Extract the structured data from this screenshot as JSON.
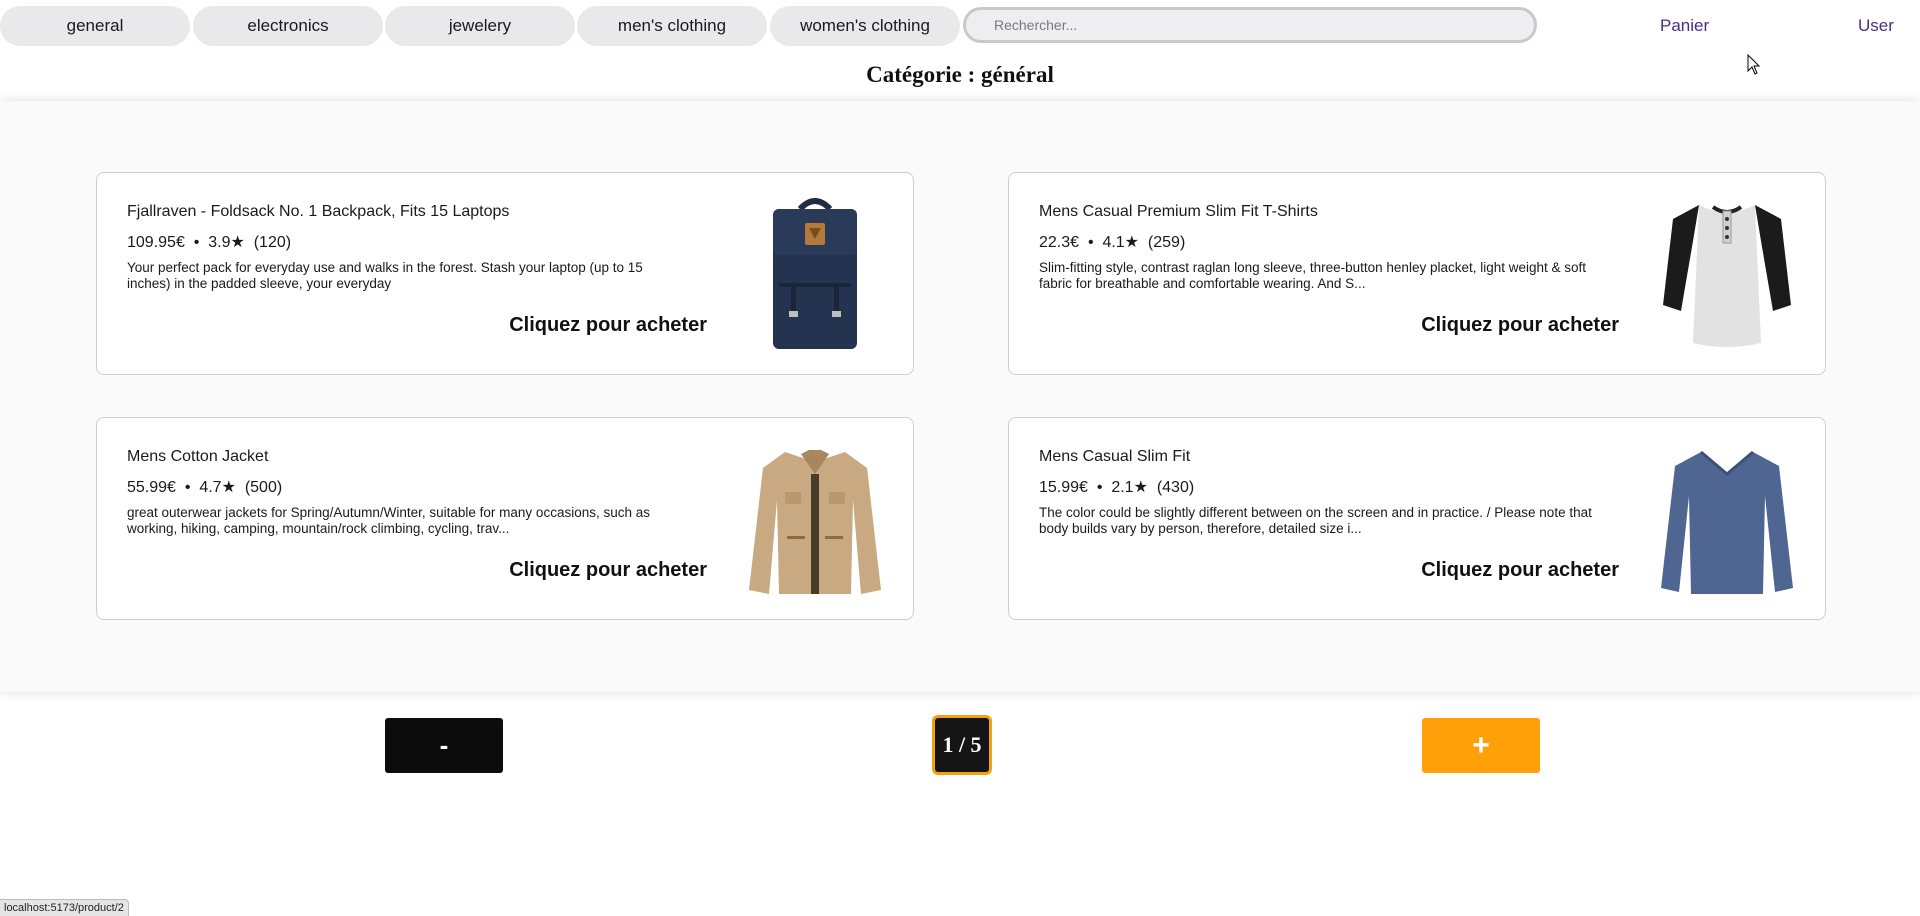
{
  "nav": {
    "categories": [
      "general",
      "electronics",
      "jewelery",
      "men's clothing",
      "women's clothing"
    ],
    "search_placeholder": "Rechercher...",
    "cart_label": "Panier",
    "user_label": "User"
  },
  "page": {
    "title": "Catégorie : général"
  },
  "products": [
    {
      "title": "Fjallraven - Foldsack No. 1 Backpack, Fits 15 Laptops",
      "price": "109.95€",
      "rating": "3.9★",
      "count": "(120)",
      "description": "Your perfect pack for everyday use and walks in the forest. Stash your laptop (up to 15 inches) in the padded sleeve, your everyday",
      "buy_label": "Cliquez pour acheter",
      "image": "backpack-image"
    },
    {
      "title": "Mens Casual Premium Slim Fit T-Shirts",
      "price": "22.3€",
      "rating": "4.1★",
      "count": "(259)",
      "description": "Slim-fitting style, contrast raglan long sleeve, three-button henley placket, light weight & soft fabric for breathable and comfortable wearing. And S...",
      "buy_label": "Cliquez pour acheter",
      "image": "raglan-shirt-image"
    },
    {
      "title": "Mens Cotton Jacket",
      "price": "55.99€",
      "rating": "4.7★",
      "count": "(500)",
      "description": "great outerwear jackets for Spring/Autumn/Winter, suitable for many occasions, such as working, hiking, camping, mountain/rock climbing, cycling, trav...",
      "buy_label": "Cliquez pour acheter",
      "image": "jacket-image"
    },
    {
      "title": "Mens Casual Slim Fit",
      "price": "15.99€",
      "rating": "2.1★",
      "count": "(430)",
      "description": "The color could be slightly different between on the screen and in practice. / Please note that body builds vary by person, therefore, detailed size i...",
      "buy_label": "Cliquez pour acheter",
      "image": "long-sleeve-shirt-image"
    }
  ],
  "pagination": {
    "prev_label": "-",
    "indicator": "1 / 5",
    "next_label": "+"
  },
  "status_bar": {
    "url": "localhost:5173/product/2"
  },
  "colors": {
    "accent_orange": "#ff9f0a",
    "link_purple": "#4b2f86",
    "chip_bg": "#e9e8ea"
  }
}
